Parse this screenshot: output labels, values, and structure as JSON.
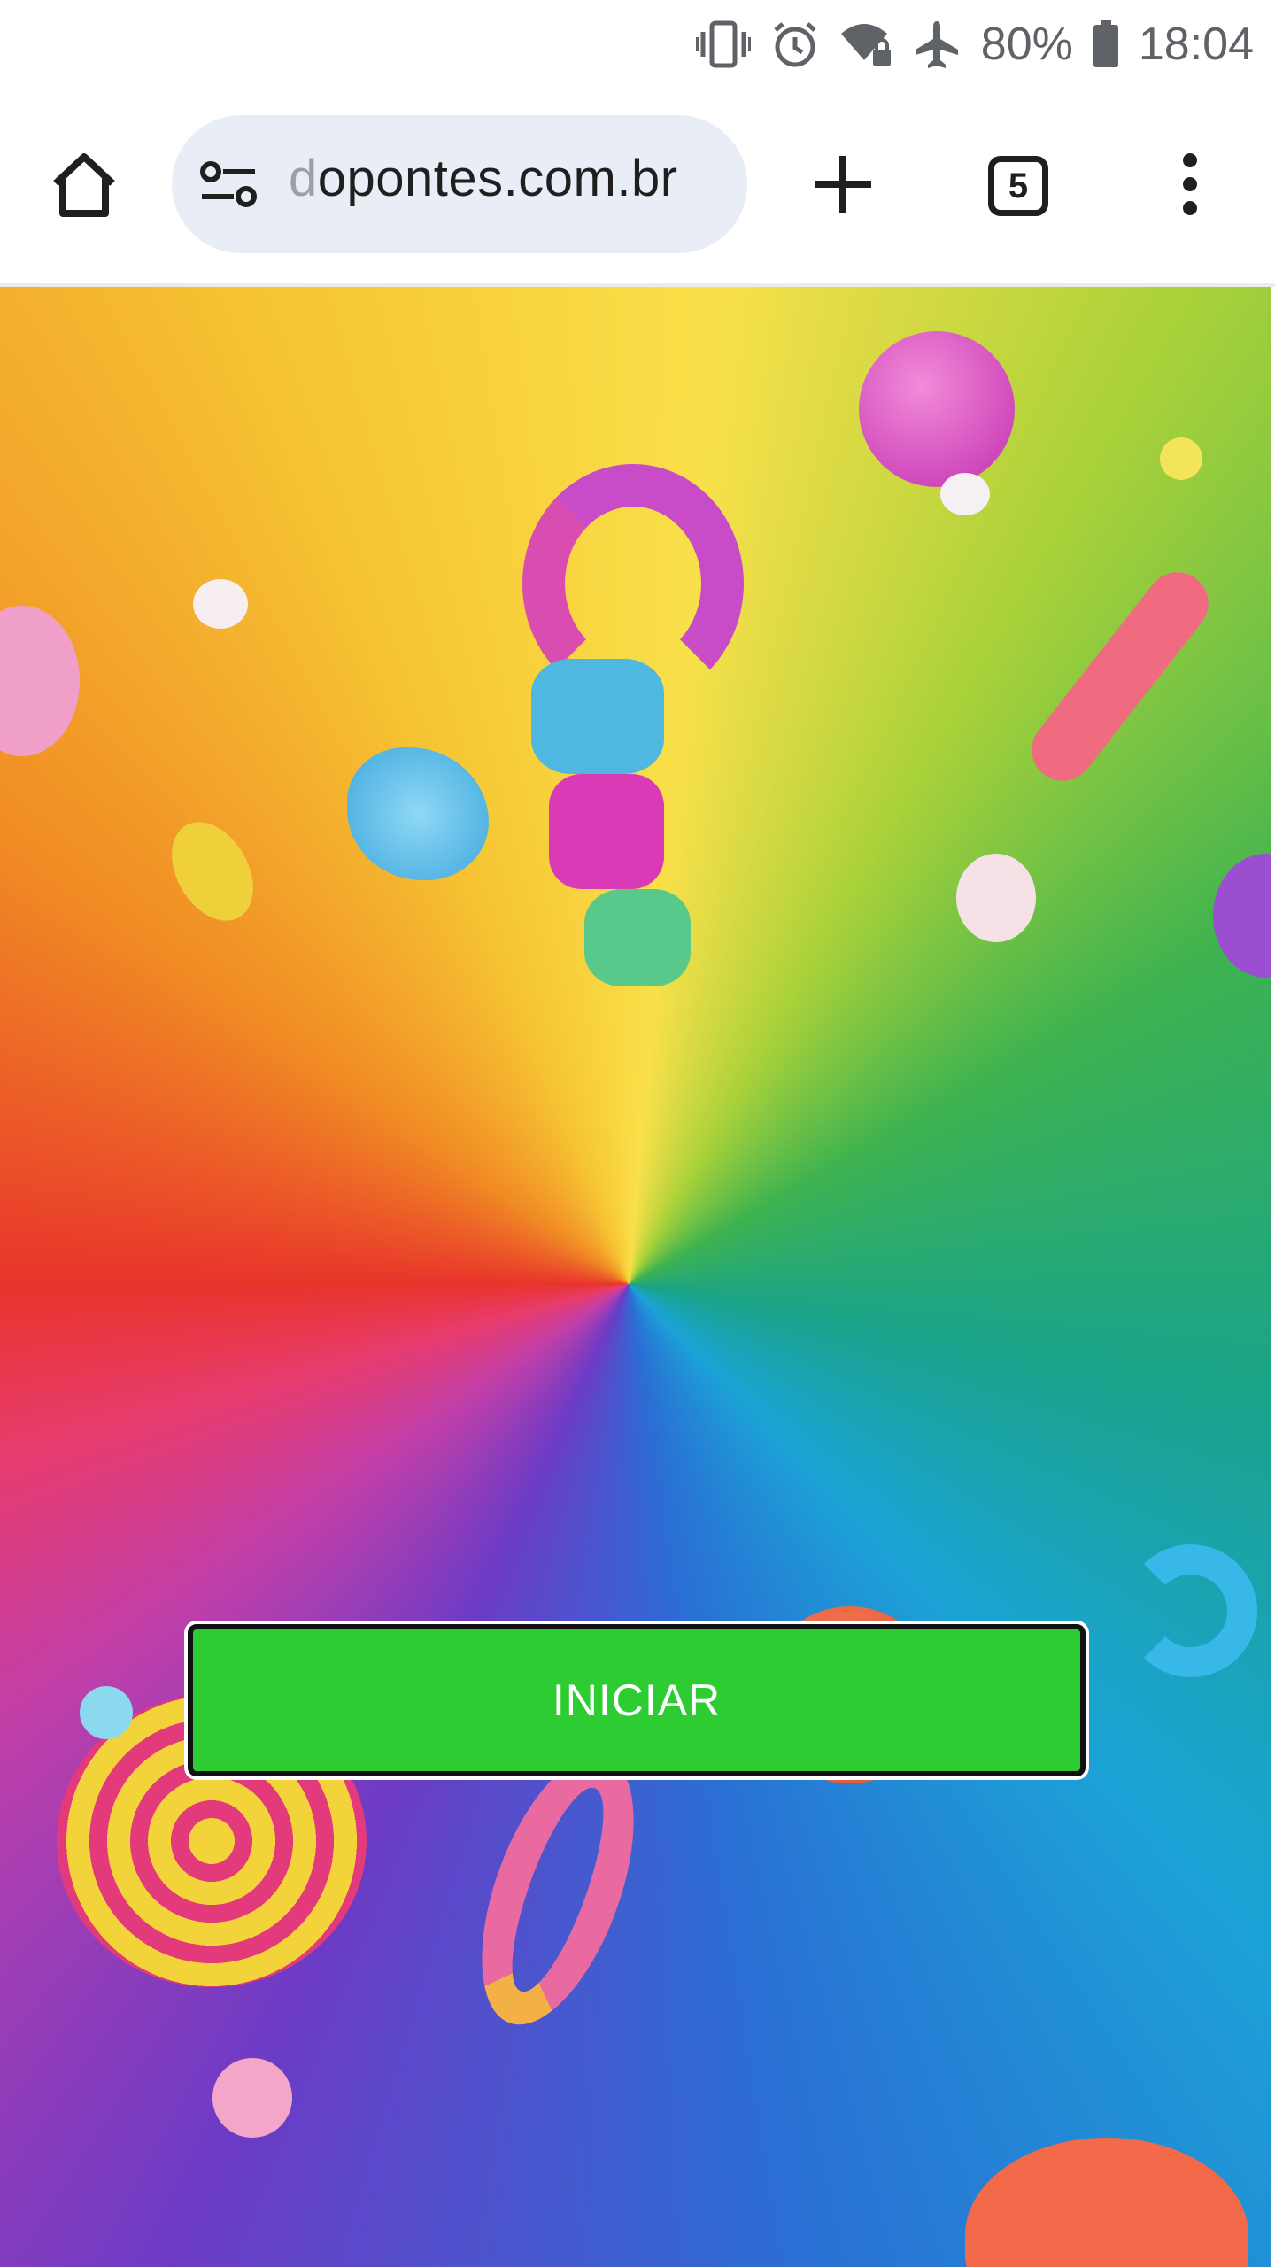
{
  "status_bar": {
    "battery_percent": "80%",
    "time": "18:04",
    "icons": [
      "vibrate-icon",
      "alarm-icon",
      "wifi-locked-icon",
      "airplane-mode-icon",
      "battery-icon"
    ]
  },
  "browser": {
    "url_prefix": "d",
    "url": "opontes.com.br",
    "tab_count": "5",
    "icons": [
      "home-icon",
      "site-settings-icon",
      "new-tab-icon",
      "tab-switcher-icon",
      "more-menu-icon"
    ]
  },
  "page": {
    "start_button_label": "INICIAR",
    "button_color": "#2ecc33"
  }
}
